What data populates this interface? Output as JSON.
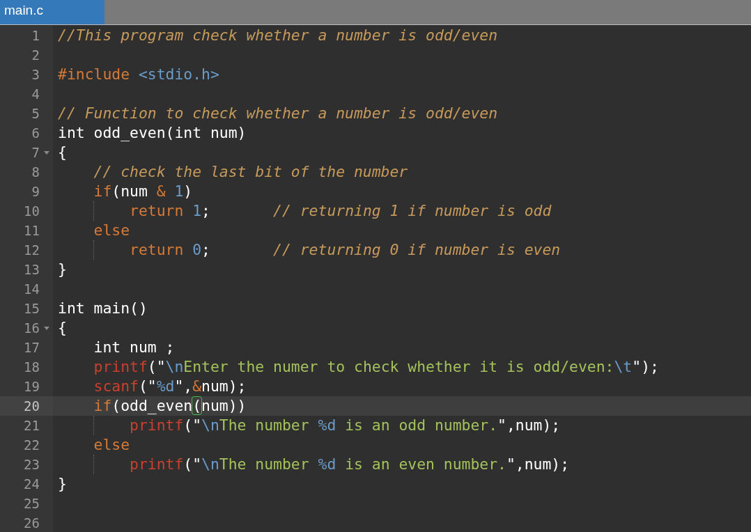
{
  "tabs": [
    {
      "label": "main.c",
      "selected": true
    }
  ],
  "lines": [
    {
      "number": "1",
      "current": false,
      "fold": false,
      "guide": false,
      "tokens": [
        {
          "kind": "comment",
          "text": "//This program check whether a number is odd/even"
        }
      ]
    },
    {
      "number": "2",
      "current": false,
      "fold": false,
      "guide": false
    },
    {
      "number": "3",
      "current": false,
      "fold": false,
      "guide": false,
      "tokens": [
        {
          "kind": "keyword",
          "text": "#include "
        },
        {
          "kind": "number",
          "text": "<stdio.h>"
        }
      ]
    },
    {
      "number": "4",
      "current": false,
      "fold": false,
      "guide": false
    },
    {
      "number": "5",
      "current": false,
      "fold": false,
      "guide": false,
      "tokens": [
        {
          "kind": "comment",
          "text": "// Function to check whether a number is odd/even"
        }
      ]
    },
    {
      "number": "6",
      "current": false,
      "fold": false,
      "guide": false,
      "tokens": [
        {
          "kind": "plain",
          "text": "int odd_even(int num)"
        }
      ]
    },
    {
      "number": "7",
      "current": false,
      "fold": true,
      "guide": false,
      "tokens": [
        {
          "kind": "plain",
          "text": "{"
        }
      ]
    },
    {
      "number": "8",
      "current": false,
      "fold": false,
      "guide": false,
      "tokens": [
        {
          "kind": "comment",
          "text": "    // check the last bit of the number"
        }
      ]
    },
    {
      "number": "9",
      "current": false,
      "fold": false,
      "guide": false,
      "tokens": [
        {
          "kind": "keyword",
          "text": "    if"
        },
        {
          "kind": "plain",
          "text": "(num "
        },
        {
          "kind": "keyword",
          "text": "& "
        },
        {
          "kind": "number",
          "text": "1"
        },
        {
          "kind": "plain",
          "text": ")"
        }
      ]
    },
    {
      "number": "10",
      "current": false,
      "fold": false,
      "guide": true,
      "tokens": [
        {
          "kind": "keyword",
          "text": "        return "
        },
        {
          "kind": "number",
          "text": "1"
        },
        {
          "kind": "plain",
          "text": ";       "
        },
        {
          "kind": "comment",
          "text": "// returning 1 if number is odd"
        }
      ]
    },
    {
      "number": "11",
      "current": false,
      "fold": false,
      "guide": false,
      "tokens": [
        {
          "kind": "keyword",
          "text": "    else"
        }
      ]
    },
    {
      "number": "12",
      "current": false,
      "fold": false,
      "guide": true,
      "tokens": [
        {
          "kind": "keyword",
          "text": "        return "
        },
        {
          "kind": "number",
          "text": "0"
        },
        {
          "kind": "plain",
          "text": ";       "
        },
        {
          "kind": "comment",
          "text": "// returning 0 if number is even"
        }
      ]
    },
    {
      "number": "13",
      "current": false,
      "fold": false,
      "guide": false,
      "tokens": [
        {
          "kind": "plain",
          "text": "}"
        }
      ]
    },
    {
      "number": "14",
      "current": false,
      "fold": false,
      "guide": false
    },
    {
      "number": "15",
      "current": false,
      "fold": false,
      "guide": false,
      "tokens": [
        {
          "kind": "plain",
          "text": "int main()"
        }
      ]
    },
    {
      "number": "16",
      "current": false,
      "fold": true,
      "guide": false,
      "tokens": [
        {
          "kind": "plain",
          "text": "{"
        }
      ]
    },
    {
      "number": "17",
      "current": false,
      "fold": false,
      "guide": false,
      "tokens": [
        {
          "kind": "plain",
          "text": "    int num ;"
        }
      ]
    },
    {
      "number": "18",
      "current": false,
      "fold": false,
      "guide": false,
      "tokens": [
        {
          "kind": "function",
          "text": "    printf"
        },
        {
          "kind": "plain",
          "text": "(\""
        },
        {
          "kind": "escape",
          "text": "\\n"
        },
        {
          "kind": "string",
          "text": "Enter the numer to check whether it is odd/even:"
        },
        {
          "kind": "escape",
          "text": "\\t"
        },
        {
          "kind": "plain",
          "text": "\");"
        }
      ]
    },
    {
      "number": "19",
      "current": false,
      "fold": false,
      "guide": false,
      "tokens": [
        {
          "kind": "function",
          "text": "    scanf"
        },
        {
          "kind": "plain",
          "text": "(\""
        },
        {
          "kind": "escape",
          "text": "%d"
        },
        {
          "kind": "plain",
          "text": "\","
        },
        {
          "kind": "keyword",
          "text": "&"
        },
        {
          "kind": "plain",
          "text": "num);"
        }
      ]
    },
    {
      "number": "20",
      "current": true,
      "fold": false,
      "guide": false,
      "tokens": [
        {
          "kind": "keyword",
          "text": "    if"
        },
        {
          "kind": "plain",
          "text": "(odd_even"
        },
        {
          "kind": "match",
          "text": "("
        },
        {
          "kind": "plain",
          "text": "num))"
        }
      ]
    },
    {
      "number": "21",
      "current": false,
      "fold": false,
      "guide": true,
      "tokens": [
        {
          "kind": "function",
          "text": "        printf"
        },
        {
          "kind": "plain",
          "text": "(\""
        },
        {
          "kind": "escape",
          "text": "\\n"
        },
        {
          "kind": "string",
          "text": "The number "
        },
        {
          "kind": "escape",
          "text": "%d"
        },
        {
          "kind": "string",
          "text": " is an odd number."
        },
        {
          "kind": "plain",
          "text": "\",num);"
        }
      ]
    },
    {
      "number": "22",
      "current": false,
      "fold": false,
      "guide": false,
      "tokens": [
        {
          "kind": "keyword",
          "text": "    else"
        }
      ]
    },
    {
      "number": "23",
      "current": false,
      "fold": false,
      "guide": true,
      "tokens": [
        {
          "kind": "function",
          "text": "        printf"
        },
        {
          "kind": "plain",
          "text": "(\""
        },
        {
          "kind": "escape",
          "text": "\\n"
        },
        {
          "kind": "string",
          "text": "The number "
        },
        {
          "kind": "escape",
          "text": "%d"
        },
        {
          "kind": "string",
          "text": " is an even number."
        },
        {
          "kind": "plain",
          "text": "\",num);"
        }
      ]
    },
    {
      "number": "24",
      "current": false,
      "fold": false,
      "guide": false,
      "tokens": [
        {
          "kind": "plain",
          "text": "}"
        }
      ]
    },
    {
      "number": "25",
      "current": false,
      "fold": false,
      "guide": false
    },
    {
      "number": "26",
      "current": false,
      "fold": false,
      "guide": false
    }
  ]
}
